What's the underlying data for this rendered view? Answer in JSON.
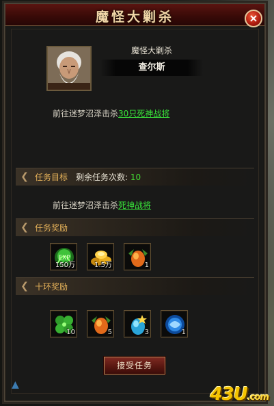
{
  "window": {
    "title": "魔怪大剿杀",
    "close_label": "×"
  },
  "npc": {
    "title": "魔怪大剿杀",
    "name": "查尔斯"
  },
  "description": {
    "prefix": "前往迷梦沼泽击杀",
    "link": "30只死神战将"
  },
  "task_goal": {
    "label": "任务目标",
    "remaining_label": "剩余任务次数:",
    "remaining_value": "10",
    "prefix": "前往迷梦沼泽击杀",
    "link": "死神战将"
  },
  "task_rewards": {
    "label": "任务奖励",
    "items": [
      {
        "icon": "exp-orb-icon",
        "count": "150万"
      },
      {
        "icon": "gold-coins-icon",
        "count": "1.5万"
      },
      {
        "icon": "golden-egg-icon",
        "count": "1"
      }
    ]
  },
  "ten_ring_rewards": {
    "label": "十环奖励",
    "items": [
      {
        "icon": "clover-icon",
        "count": "10"
      },
      {
        "icon": "golden-egg-icon",
        "count": "5"
      },
      {
        "icon": "blue-egg-icon",
        "count": "3"
      },
      {
        "icon": "blue-orb-icon",
        "count": "1"
      }
    ]
  },
  "accept_button": {
    "label": "接受任务"
  },
  "watermark": {
    "main": "43U",
    "suffix": ".com"
  },
  "colors": {
    "title_bg": "#3a0b08",
    "link": "#39e23a",
    "section_label": "#e7b35a",
    "accent_border": "#5f4d31"
  }
}
